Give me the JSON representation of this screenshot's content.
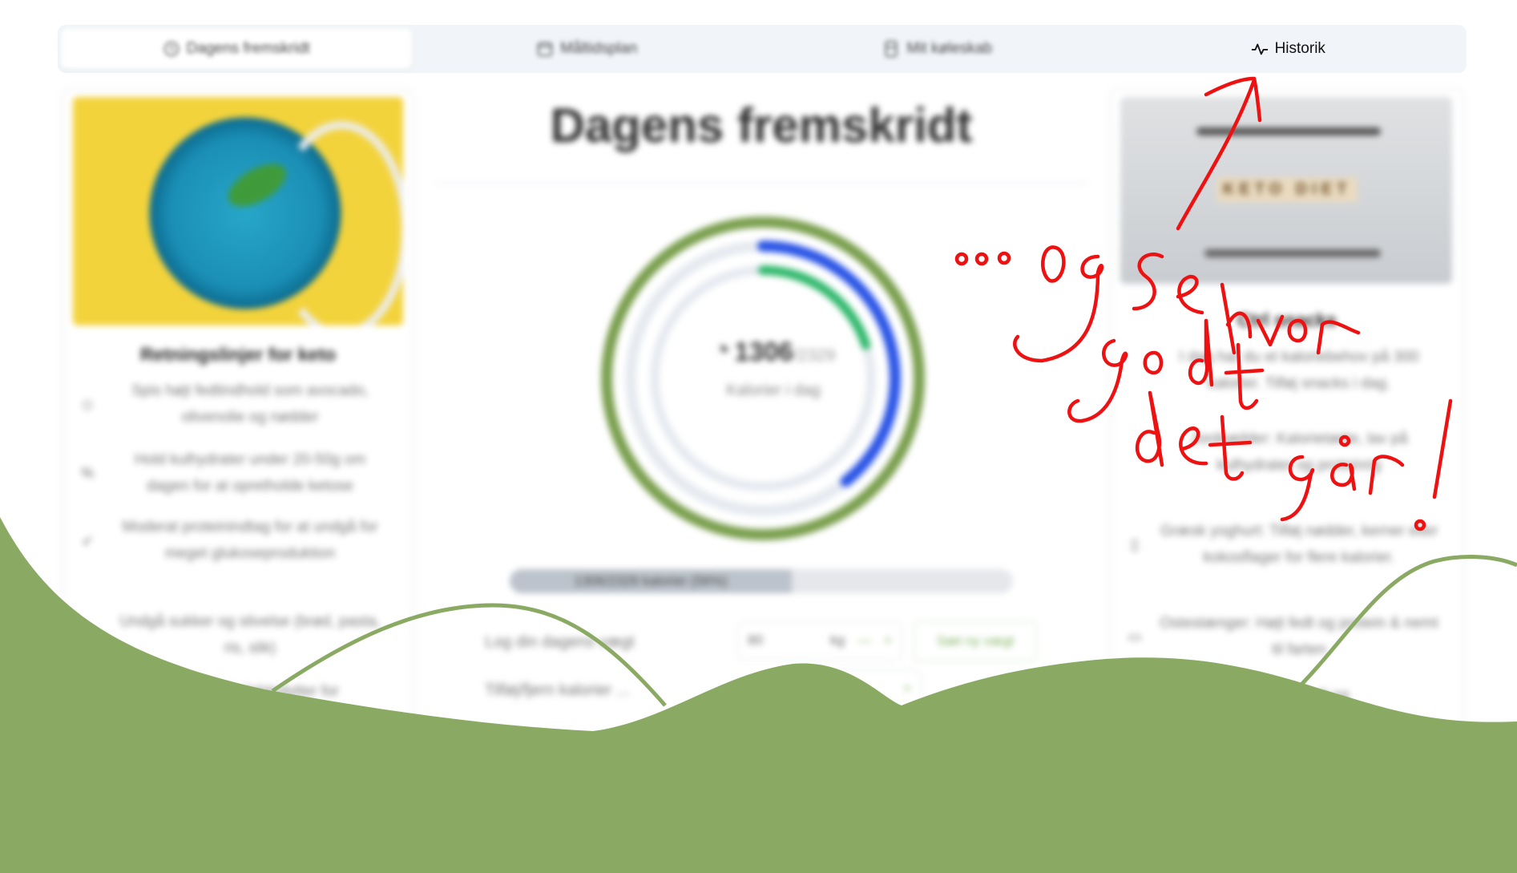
{
  "tabs": [
    {
      "label": "Dagens fremskridt",
      "icon": "clock-icon",
      "active": true
    },
    {
      "label": "Måltidsplan",
      "icon": "calendar-icon",
      "active": false
    },
    {
      "label": "Mit køleskab",
      "icon": "fridge-icon",
      "active": false
    },
    {
      "label": "Historik",
      "icon": "activity-icon",
      "active": false
    }
  ],
  "left_panel": {
    "title": "Retningslinjer for keto",
    "items": [
      {
        "icon": "droplet-icon",
        "text": "Spis højt fedtindhold som avocado, olivenolie og nødder"
      },
      {
        "icon": "percent-icon",
        "text": "Hold kulhydrater under 20-50g om dagen for at opretholde ketose"
      },
      {
        "icon": "leaf-icon",
        "text": "Moderat proteinindtag for at undgå for meget glukoseproduktion"
      },
      {
        "icon": "ban-icon",
        "text": "Undgå sukker og stivelse (brød, pasta, ris, slik)"
      },
      {
        "icon": "pill-icon",
        "text": "...tilskud af elektrolytter for"
      }
    ]
  },
  "main": {
    "title": "Dagens fremskridt",
    "calories_current": "1306",
    "calories_goal": "/2329",
    "calories_label": "Kalorier i dag",
    "progress_fraction": 0.56,
    "progress_text": "1306/2329 kalorier (56%)",
    "weight_label": "Log din dagens vægt",
    "weight_value": "80",
    "weight_unit": "kg",
    "weight_button": "Sæt ny vægt",
    "calories_row_label": "Tilføj/fjern kalorier ..."
  },
  "right_panel": {
    "title": "Ctrl snacks",
    "items": [
      {
        "icon": "",
        "text": "I dag har du et kaloriebehov på 300 kalorier. Tilføj snacks i dag."
      },
      {
        "icon": "",
        "text": "Jordnødder: Kalorietætte, lav på kulhydrater og proteinrig"
      },
      {
        "icon": "cup-icon",
        "text": "Græsk yoghurt: Tilføj nødder, kerner eller kokosflager for flere kalorier."
      },
      {
        "icon": "cheese-icon",
        "text": "Ostestænger: Højt fedt og protein & nemt til farten"
      },
      {
        "icon": "",
        "text": "...: Højt fedt og"
      }
    ]
  },
  "annotation_text": "°°° Og se hvor godt det går!",
  "colors": {
    "green_wave": "#8aaa63",
    "ring_outer": "#7a9f4e",
    "ring_blue": "#2b55e6",
    "ring_green": "#2fb86b",
    "annotation_red": "#ee1111"
  }
}
